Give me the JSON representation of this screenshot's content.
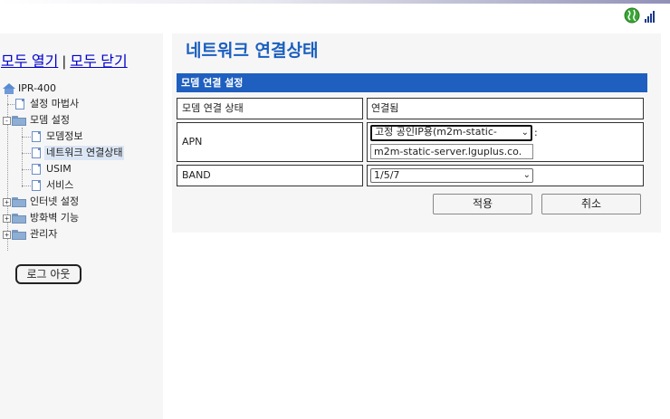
{
  "header": {
    "globe_icon": "globe-icon",
    "signal_icon": "signal-bars-icon"
  },
  "sidebar": {
    "expand_all": "모두 열기",
    "separator": "|",
    "collapse_all": "모두 닫기",
    "tree": {
      "root": "IPR-400",
      "items": [
        {
          "label": "설정 마법사",
          "type": "page"
        },
        {
          "label": "모뎀 설정",
          "type": "folder",
          "toggle": "-"
        },
        {
          "label": "모뎀정보",
          "type": "page"
        },
        {
          "label": "네트워크 연결상태",
          "type": "page",
          "selected": true
        },
        {
          "label": "USIM",
          "type": "page"
        },
        {
          "label": "서비스",
          "type": "page"
        },
        {
          "label": "인터넷 설정",
          "type": "folder",
          "toggle": "+"
        },
        {
          "label": "방화벽 기능",
          "type": "folder",
          "toggle": "+"
        },
        {
          "label": "관리자",
          "type": "folder",
          "toggle": "+"
        }
      ]
    },
    "logout": "로그 아웃"
  },
  "main": {
    "title": "네트워크 연결상태",
    "section_title": "모뎀 연결 설정",
    "rows": {
      "status": {
        "label": "모뎀 연결 상태",
        "value": "연결됨"
      },
      "apn": {
        "label": "APN",
        "select_value": "고정 공인IP용(m2m-static-",
        "suffix": ":",
        "input_value": "m2m-static-server.lguplus.co."
      },
      "band": {
        "label": "BAND",
        "select_value": "1/5/7"
      }
    },
    "buttons": {
      "apply": "적용",
      "cancel": "취소"
    }
  }
}
